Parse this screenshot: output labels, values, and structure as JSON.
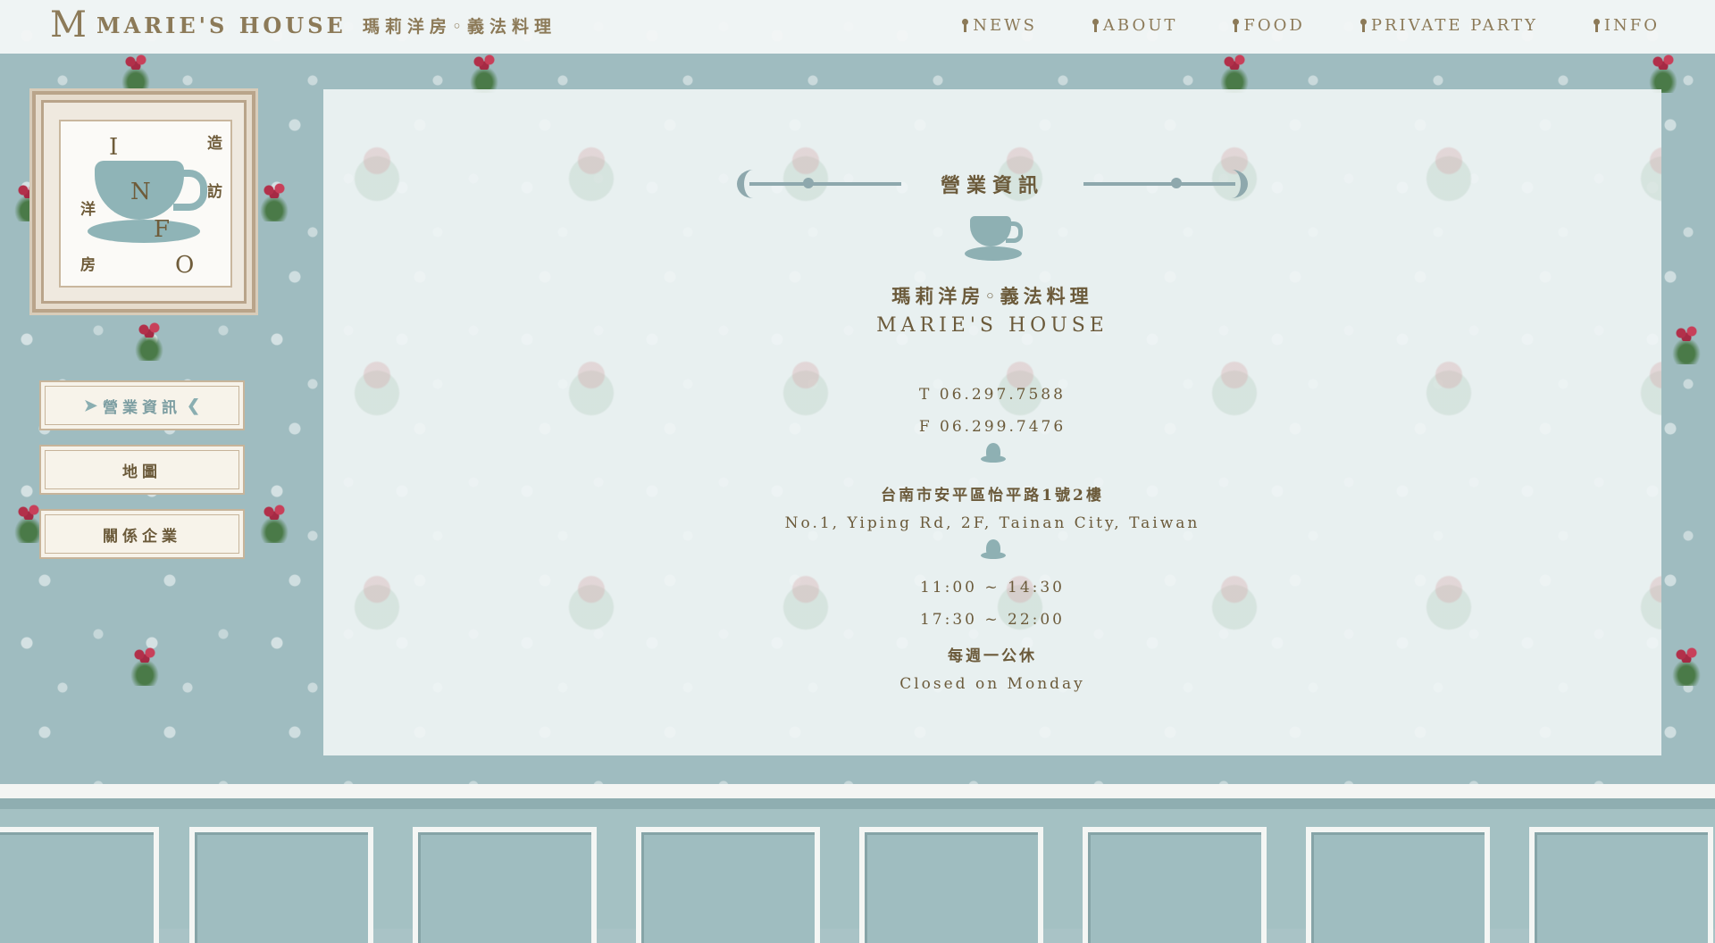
{
  "header": {
    "logo_mark": "M",
    "brand_en": "MARIE'S HOUSE",
    "brand_zh": "瑪莉洋房◦義法料理",
    "nav": [
      {
        "label": "NEWS"
      },
      {
        "label": "ABOUT"
      },
      {
        "label": "FOOD"
      },
      {
        "label": "PRIVATE PARTY"
      },
      {
        "label": "INFO"
      }
    ]
  },
  "sidebar": {
    "frame_letters": [
      "I",
      "N",
      "F",
      "O"
    ],
    "frame_zh": [
      "造",
      "訪",
      "洋",
      "房"
    ],
    "buttons": [
      {
        "label": "營業資訊"
      },
      {
        "label": "地圖"
      },
      {
        "label": "關係企業"
      }
    ]
  },
  "main": {
    "section_title": "營業資訊",
    "name_zh": "瑪莉洋房◦義法料理",
    "name_en": "MARIE'S HOUSE",
    "tel": "T 06.297.7588",
    "fax": "F 06.299.7476",
    "address_zh": "台南市安平區怡平路1號2樓",
    "address_en": "No.1, Yiping Rd, 2F, Tainan City, Taiwan",
    "hours_1": "11:00 ~ 14:30",
    "hours_2": "17:30 ~ 22:00",
    "closed_zh": "每週一公休",
    "closed_en": "Closed on Monday"
  },
  "colors": {
    "gold_text": "#8c7a58",
    "dark_text": "#6b5a3a",
    "wall_blue": "#9fbcc0"
  }
}
